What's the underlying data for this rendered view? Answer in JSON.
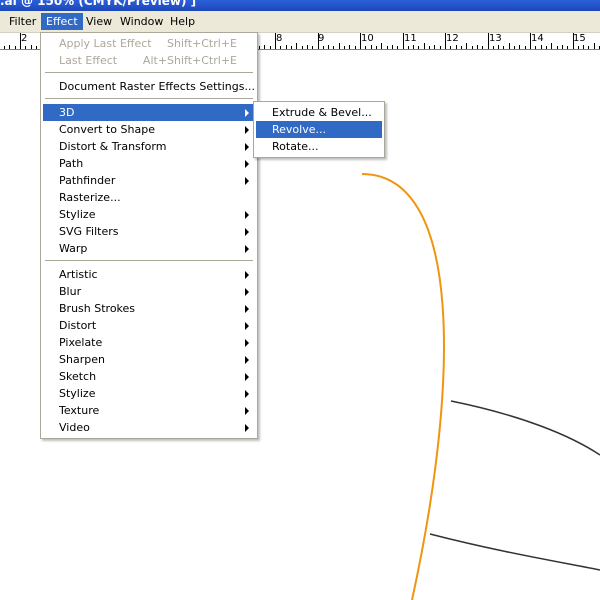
{
  "window": {
    "title": ".ai @ 150% (CMYK/Preview) ]"
  },
  "menubar": {
    "items": [
      {
        "label": "Filter"
      },
      {
        "label": "Effect"
      },
      {
        "label": "View"
      },
      {
        "label": "Window"
      },
      {
        "label": "Help"
      }
    ]
  },
  "ruler": {
    "labels": [
      "2",
      "8",
      "9",
      "10",
      "11",
      "12",
      "13",
      "14",
      "15"
    ]
  },
  "effect_menu": {
    "items": [
      {
        "label": "Apply Last Effect",
        "shortcut": "Shift+Ctrl+E"
      },
      {
        "label": "Last Effect",
        "shortcut": "Alt+Shift+Ctrl+E"
      },
      {
        "label": "Document Raster Effects Settings..."
      },
      {
        "label": "3D"
      },
      {
        "label": "Convert to Shape"
      },
      {
        "label": "Distort & Transform"
      },
      {
        "label": "Path"
      },
      {
        "label": "Pathfinder"
      },
      {
        "label": "Rasterize..."
      },
      {
        "label": "Stylize"
      },
      {
        "label": "SVG Filters"
      },
      {
        "label": "Warp"
      },
      {
        "label": "Artistic"
      },
      {
        "label": "Blur"
      },
      {
        "label": "Brush Strokes"
      },
      {
        "label": "Distort"
      },
      {
        "label": "Pixelate"
      },
      {
        "label": "Sharpen"
      },
      {
        "label": "Sketch"
      },
      {
        "label": "Stylize"
      },
      {
        "label": "Texture"
      },
      {
        "label": "Video"
      }
    ]
  },
  "submenu_3d": {
    "items": [
      {
        "label": "Extrude & Bevel..."
      },
      {
        "label": "Revolve..."
      },
      {
        "label": "Rotate..."
      }
    ]
  },
  "colors": {
    "title_bar": "#2456d2",
    "menu_bar": "#ece9d8",
    "highlight": "#316ac5",
    "disabled_text": "#aca899",
    "orange_path": "#f0950f",
    "dark_path": "#333333"
  }
}
